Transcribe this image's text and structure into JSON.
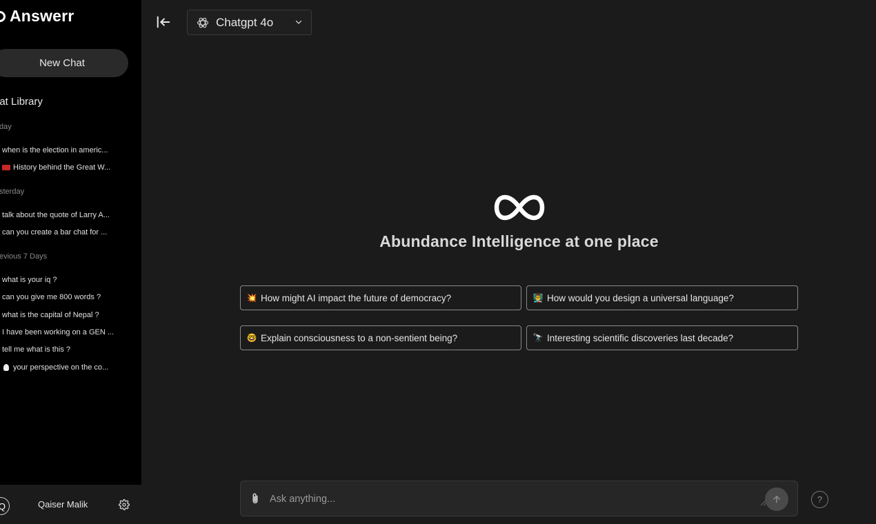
{
  "brand": {
    "name": "Answerr"
  },
  "sidebar": {
    "new_chat_label": "New Chat",
    "library_title": "hat Library",
    "sections": [
      {
        "label": "day",
        "items": [
          {
            "icon": "",
            "label": "when is the election in americ..."
          },
          {
            "icon": "flag-icon",
            "label": "History behind the Great W..."
          }
        ]
      },
      {
        "label": "sterday",
        "items": [
          {
            "icon": "",
            "label": "talk about the quote of Larry A..."
          },
          {
            "icon": "",
            "label": "can you create a bar chat for ..."
          }
        ]
      },
      {
        "label": "evious 7 Days",
        "items": [
          {
            "icon": "",
            "label": "what is your iq ?"
          },
          {
            "icon": "",
            "label": "can you give me 800 words ?"
          },
          {
            "icon": "",
            "label": "what is the capital of Nepal ?"
          },
          {
            "icon": "",
            "label": "I have been working on a GEN ..."
          },
          {
            "icon": "",
            "label": "tell me what is this ?"
          },
          {
            "icon": "bulb-icon",
            "label": "your perspective on the co..."
          }
        ]
      }
    ],
    "user": {
      "avatar_initial": "Q",
      "name": "Qaiser Malik"
    }
  },
  "topbar": {
    "model_label": "Chatgpt 4o"
  },
  "hero": {
    "title": "Abundance Intelligence at one place"
  },
  "suggestions": [
    {
      "icon": "💥",
      "label": "How might AI impact the future of democracy?"
    },
    {
      "icon": "👨‍🏫",
      "label": "How would you design a universal language?"
    },
    {
      "icon": "🤓",
      "label": "Explain consciousness to a non-sentient being?"
    },
    {
      "icon": "🔭",
      "label": "Interesting scientific discoveries last decade?"
    }
  ],
  "composer": {
    "placeholder": "Ask anything..."
  },
  "help": {
    "label": "?"
  },
  "colors": {
    "sidebar_bg": "#000000",
    "main_bg": "#1b1b1b",
    "accent_border": "#8a8a8a"
  }
}
